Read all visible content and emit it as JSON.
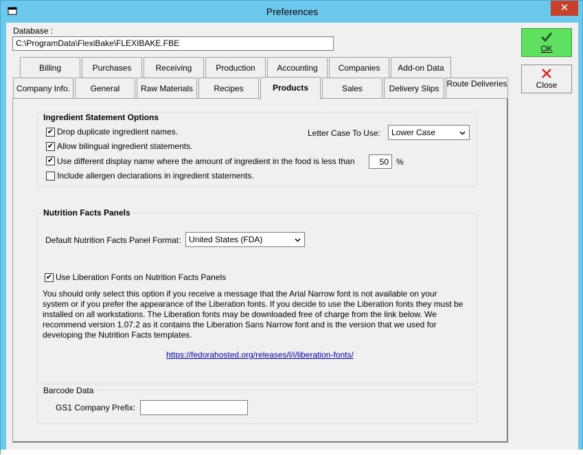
{
  "window": {
    "title": "Preferences",
    "close_glyph": "✕"
  },
  "database": {
    "label": "Database :",
    "path": "C:\\ProgramData\\FlexiBake\\FLEXIBAKE.FBE"
  },
  "buttons": {
    "ok": {
      "label": "OK",
      "icon": "check-icon",
      "color": "#5fe060"
    },
    "close": {
      "label": "Close",
      "icon": "x-icon",
      "icon_color": "#d22a2a"
    }
  },
  "tabs_row1": [
    "Billing",
    "Purchases",
    "Receiving",
    "Production",
    "Accounting",
    "Companies",
    "Add-on Data"
  ],
  "tabs_row2": [
    "Company Info.",
    "General",
    "Raw Materials",
    "Recipes",
    "Products",
    "Sales",
    "Delivery Slips",
    "Route Deliveries"
  ],
  "active_tab": "Products",
  "ingredient": {
    "title": "Ingredient Statement Options",
    "drop_duplicates": {
      "label": "Drop duplicate ingredient names.",
      "checked": true
    },
    "bilingual": {
      "label": "Allow bilingual ingredient statements.",
      "checked": true
    },
    "display_name": {
      "label": "Use different display name where the amount of ingredient in the food is less than",
      "checked": true,
      "value": "50",
      "unit": "%"
    },
    "allergen": {
      "label": "Include allergen declarations in ingredient statements.",
      "checked": false
    },
    "letter_case": {
      "label": "Letter Case To Use:",
      "value": "Lower Case"
    }
  },
  "nutrition": {
    "title": "Nutrition Facts Panels",
    "format_label": "Default Nutrition Facts Panel Format:",
    "format_value": "United States (FDA)",
    "liberation": {
      "label": "Use Liberation Fonts on Nutrition Facts Panels",
      "checked": true
    },
    "description": [
      "You should only select this option if you receive a message that the Arial Narrow font is not available on your",
      "system or if you prefer the appearance of the Liberation fonts. If you decide to use the Liberation fonts they must be",
      "installed on all workstations. The Liberation fonts may be downloaded free of charge from the link below. We",
      "recommend version 1.07.2 as it contains the Liberation Sans Narrow font and is the version that we used for",
      "developing the Nutrition Facts templates."
    ],
    "link": "https://fedorahosted.org/releases/l/i/liberation-fonts/"
  },
  "barcode": {
    "title": "Barcode Data",
    "prefix_label": "GS1 Company Prefix:",
    "prefix_value": ""
  },
  "colors": {
    "titlebar": "#6cc8ec",
    "window_bg": "#f0f0f0",
    "link": "#0000c8"
  }
}
